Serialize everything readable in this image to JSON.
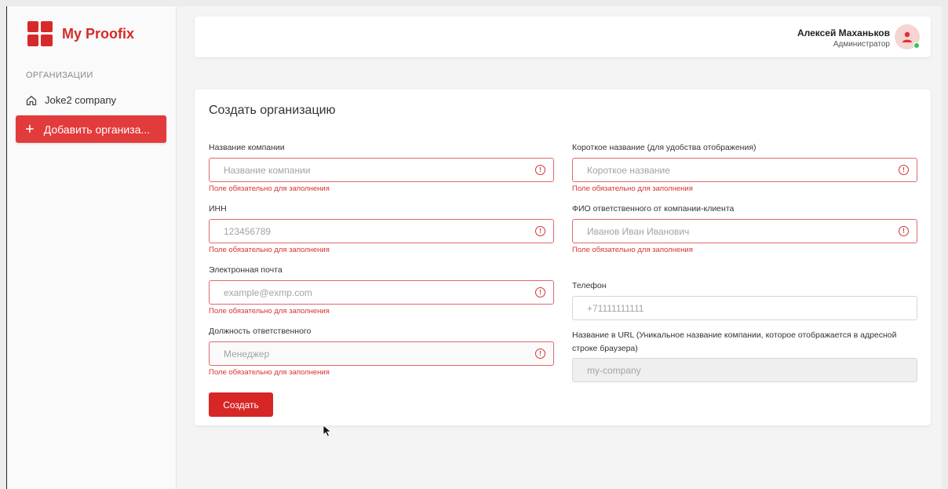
{
  "brand": {
    "name": "My Proofix",
    "color": "#d62a2a"
  },
  "sidebar": {
    "section_title": "ОРГАНИЗАЦИИ",
    "items": [
      {
        "icon": "home-icon",
        "label": "Joke2 company"
      }
    ],
    "add_button": {
      "icon": "plus-icon",
      "label": "Добавить организа..."
    }
  },
  "header": {
    "user_name": "Алексей Маханьков",
    "user_role": "Администратор",
    "avatar_icon": "user-icon",
    "status": "online"
  },
  "form": {
    "title": "Создать организацию",
    "fields": {
      "company_name": {
        "label": "Название компании",
        "placeholder": "Название компании",
        "error": "Поле обязательно для заполнения"
      },
      "short_name": {
        "label": "Короткое название (для удобства отображения)",
        "placeholder": "Короткое название",
        "error": "Поле обязательно для заполнения"
      },
      "inn": {
        "label": "ИНН",
        "placeholder": "123456789",
        "error": "Поле обязательно для заполнения"
      },
      "responsible": {
        "label": "ФИО ответственного от компании-клиента",
        "placeholder": "Иванов Иван Иванович",
        "error": "Поле обязательно для заполнения"
      },
      "email": {
        "label": "Электронная почта",
        "placeholder": "example@exmp.com",
        "error": "Поле обязательно для заполнения"
      },
      "phone": {
        "label": "Телефон",
        "placeholder": "+71111111111"
      },
      "position": {
        "label": "Должность ответственного",
        "placeholder": "Менеджер",
        "error": "Поле обязательно для заполнения"
      },
      "url_name": {
        "label": "Название в URL (Уникальное название компании, которое отображается в адресной строке браузера)",
        "placeholder": "my-company"
      }
    },
    "error_icon": "alert-circle-icon",
    "submit_label": "Создать"
  },
  "colors": {
    "accent": "#d62626",
    "error": "#d63333",
    "online": "#2ec45f"
  }
}
